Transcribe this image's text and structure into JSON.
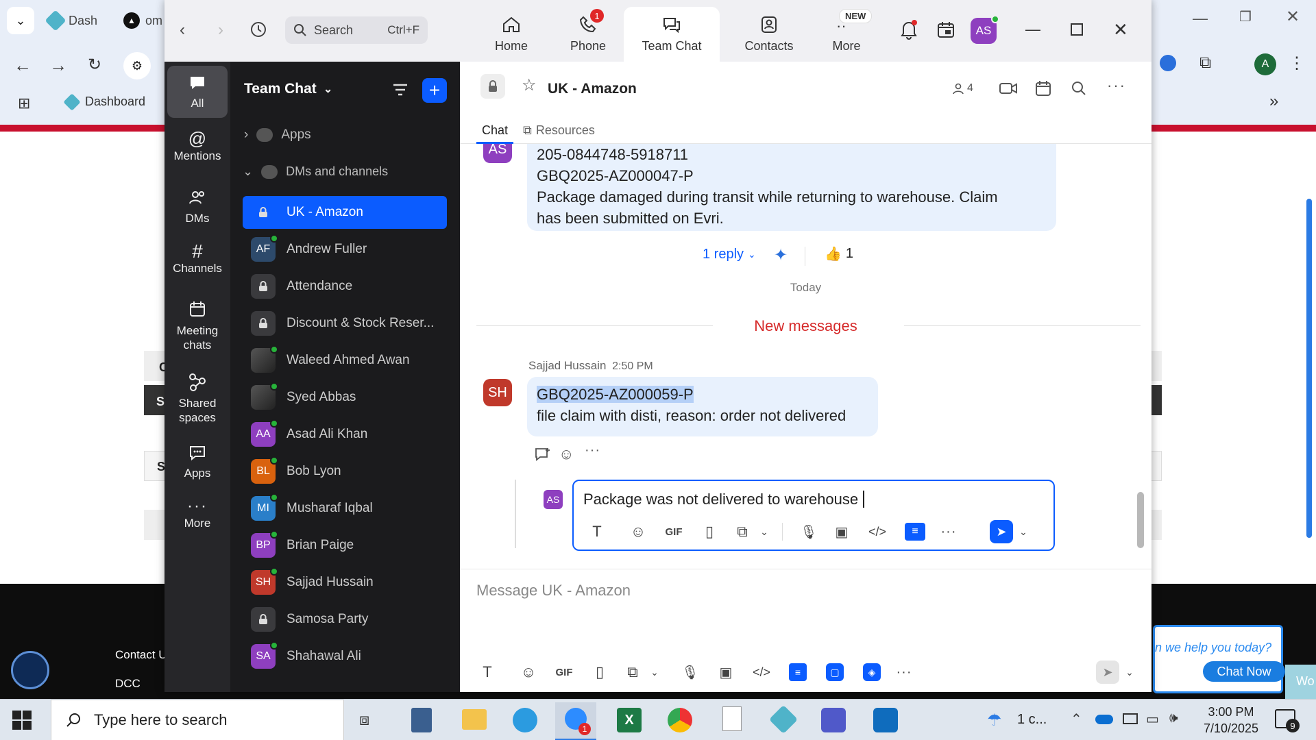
{
  "browser": {
    "tab1": "Dash",
    "tab2": "om",
    "bookmark": "Dashboard",
    "profile_initial": "A",
    "footer_link1": "Contact U",
    "footer_link2": "DCC",
    "chat_widget_text": "n we help you today?",
    "chat_widget_button": "Chat Now",
    "chat_widget_extra": "Wo",
    "bg_letters": [
      "C",
      "S",
      "S"
    ]
  },
  "zoom": {
    "search_label": "Search",
    "search_shortcut": "Ctrl+F",
    "nav": [
      {
        "label": "Home",
        "icon": "home-icon"
      },
      {
        "label": "Phone",
        "icon": "phone-icon",
        "badge": "1"
      },
      {
        "label": "Team Chat",
        "icon": "chat-icon"
      },
      {
        "label": "Contacts",
        "icon": "contacts-icon"
      },
      {
        "label": "More",
        "icon": "more-icon",
        "badge": "NEW"
      }
    ],
    "user_initials": "AS",
    "rail": [
      {
        "label": "All"
      },
      {
        "label": "Mentions"
      },
      {
        "label": "DMs"
      },
      {
        "label": "Channels"
      },
      {
        "label": "Meeting chats"
      },
      {
        "label": "Shared spaces"
      },
      {
        "label": "Apps"
      },
      {
        "label": "More"
      }
    ],
    "sidebar": {
      "title": "Team Chat",
      "apps_label": "Apps",
      "dms_label": "DMs and channels",
      "channels": [
        {
          "name": "UK - Amazon",
          "type": "lock",
          "selected": true
        },
        {
          "name": "Andrew Fuller",
          "initials": "AF",
          "color": "#2d4a6b",
          "online": true
        },
        {
          "name": "Attendance",
          "type": "lock"
        },
        {
          "name": "Discount & Stock Reser...",
          "type": "lock"
        },
        {
          "name": "Waleed Ahmed Awan",
          "type": "photo",
          "online": true
        },
        {
          "name": "Syed Abbas",
          "type": "photo",
          "online": true
        },
        {
          "name": "Asad Ali Khan",
          "initials": "AA",
          "color": "#8e3fbf",
          "online": true
        },
        {
          "name": "Bob Lyon",
          "initials": "BL",
          "color": "#d9620e",
          "online": true
        },
        {
          "name": "Musharaf Iqbal",
          "initials": "MI",
          "color": "#2a7fc9",
          "online": true
        },
        {
          "name": "Brian Paige",
          "initials": "BP",
          "color": "#8e3fbf",
          "online": true
        },
        {
          "name": "Sajjad Hussain",
          "initials": "SH",
          "color": "#c0392b",
          "online": true
        },
        {
          "name": "Samosa Party",
          "type": "lock"
        },
        {
          "name": "Shahawal Ali",
          "initials": "SA",
          "color": "#8e3fbf",
          "online": true
        }
      ]
    },
    "channel": {
      "name": "UK - Amazon",
      "members": "4",
      "tabs": [
        "Chat",
        "Resources"
      ]
    },
    "messages": {
      "prev_avatar": "AS",
      "prev_lines": [
        "205-0844748-5918711",
        "GBQ2025-AZ000047-P",
        "Package damaged during transit while returning to warehouse. Claim",
        "has been submitted on Evri."
      ],
      "reply_label": "1 reply",
      "reaction": "👍",
      "reaction_count": "1",
      "day_divider": "Today",
      "new_divider": "New messages",
      "new_author": "Sajjad Hussain",
      "new_time": "2:50 PM",
      "new_avatar": "SH",
      "new_line1": "GBQ2025-AZ000059-P",
      "new_line2": "file claim with disti, reason: order not delivered"
    },
    "reply_composer": {
      "avatar": "AS",
      "value": "Package was not delivered to warehouse "
    },
    "composer": {
      "placeholder": "Message UK - Amazon"
    },
    "gif_label": "GIF"
  },
  "taskbar": {
    "search_placeholder": "Type here to search",
    "weather": "1 c...",
    "time": "3:00 PM",
    "date": "7/10/2025",
    "notif_count": "9",
    "zoom_badge": "1"
  }
}
